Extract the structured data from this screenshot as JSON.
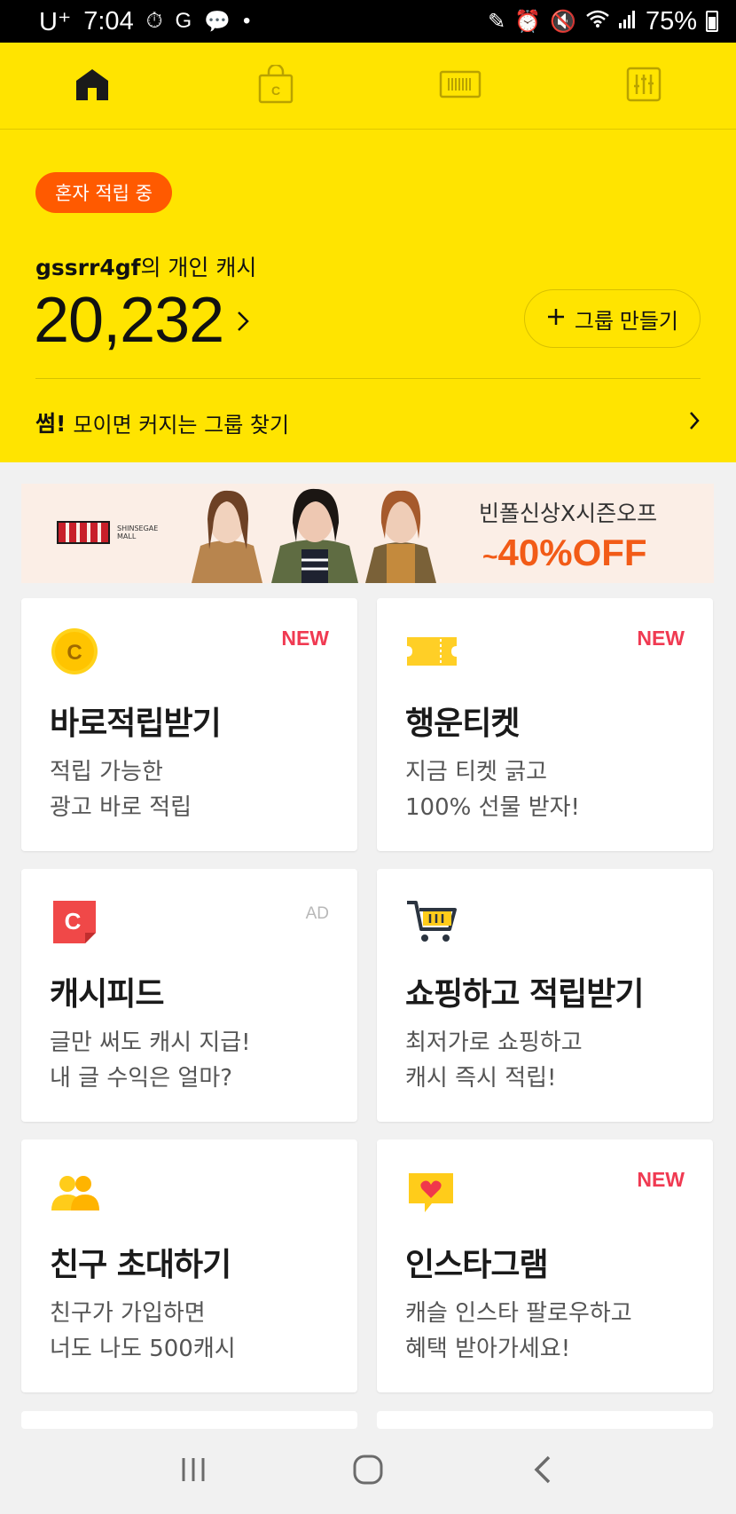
{
  "status_bar": {
    "carrier": "U⁺",
    "time": "7:04",
    "battery": "75%"
  },
  "tabs": [
    {
      "name": "home",
      "icon": "home-icon",
      "active": true
    },
    {
      "name": "shop",
      "icon": "shopping-bag-icon",
      "active": false
    },
    {
      "name": "barcode",
      "icon": "barcode-icon",
      "active": false
    },
    {
      "name": "settings",
      "icon": "sliders-icon",
      "active": false
    }
  ],
  "hero": {
    "status_pill": "혼자 적립 중",
    "username": "gssrr4gf",
    "owner_suffix": "의 개인 캐시",
    "balance": "20,232",
    "make_group_label": "그룹 만들기",
    "find_group_bold": "썸!",
    "find_group_text": "모이면 커지는 그룹 찾기"
  },
  "banner": {
    "logo_text_1": "SHINSEGAE",
    "logo_text_2": "MALL",
    "headline": "빈폴신상X시즌오프",
    "discount_prefix": "~",
    "discount": "40%OFF"
  },
  "cards": [
    {
      "title": "바로적립받기",
      "line1": "적립 가능한",
      "line2": "광고 바로 적립",
      "badge": "NEW",
      "icon": "coin-icon"
    },
    {
      "title": "행운티켓",
      "line1": "지금 티켓 긁고",
      "line2": "100% 선물 받자!",
      "badge": "NEW",
      "icon": "ticket-icon"
    },
    {
      "title": "캐시피드",
      "line1": "글만 써도 캐시 지급!",
      "line2": "내 글 수익은 얼마?",
      "badge": "AD",
      "icon": "cashfeed-icon"
    },
    {
      "title": "쇼핑하고 적립받기",
      "line1": "최저가로 쇼핑하고",
      "line2": "캐시 즉시 적립!",
      "badge": "",
      "icon": "cart-icon"
    },
    {
      "title": "친구 초대하기",
      "line1": "친구가 가입하면",
      "line2": "너도 나도 500캐시",
      "badge": "",
      "icon": "friends-icon"
    },
    {
      "title": "인스타그램",
      "line1": "캐슬 인스타 팔로우하고",
      "line2": "혜택 받아가세요!",
      "badge": "NEW",
      "icon": "heart-message-icon"
    }
  ],
  "colors": {
    "brand_yellow": "#ffe400",
    "pill_orange": "#ff5a00",
    "new_red": "#f03a52"
  }
}
